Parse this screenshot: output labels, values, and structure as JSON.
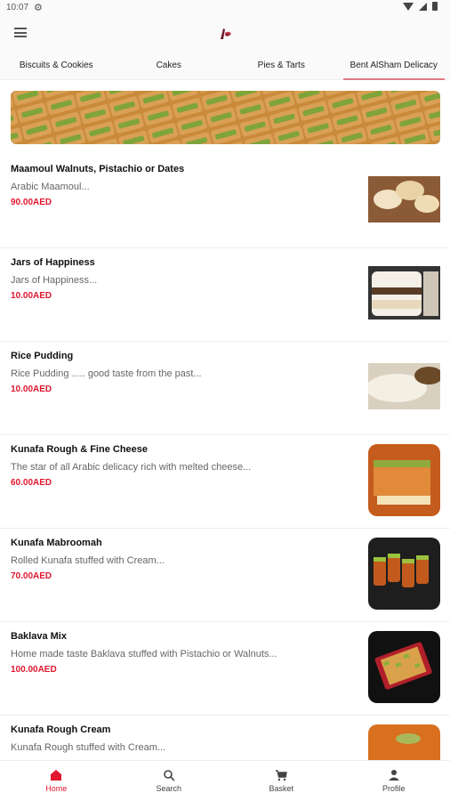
{
  "status": {
    "time": "10:07"
  },
  "tabs": [
    {
      "label": "Biscuits & Cookies"
    },
    {
      "label": "Cakes"
    },
    {
      "label": "Pies & Tarts"
    },
    {
      "label": "Bent AlSham Delicacy"
    }
  ],
  "items": [
    {
      "name": "Maamoul Walnuts, Pistachio or Dates",
      "desc": "Arabic Maamoul...",
      "price": "90.00AED"
    },
    {
      "name": "Jars of Happiness",
      "desc": "Jars of Happiness...",
      "price": "10.00AED"
    },
    {
      "name": "Rice Pudding",
      "desc": "Rice Pudding ..... good taste from the past...",
      "price": "10.00AED"
    },
    {
      "name": "Kunafa Rough & Fine Cheese",
      "desc": "The star of all Arabic delicacy rich with melted cheese...",
      "price": "60.00AED"
    },
    {
      "name": "Kunafa Mabroomah",
      "desc": "Rolled Kunafa stuffed with Cream...",
      "price": "70.00AED"
    },
    {
      "name": "Baklava Mix",
      "desc": "Home made taste Baklava stuffed with Pistachio or Walnuts...",
      "price": "100.00AED"
    },
    {
      "name": "Kunafa Rough Cream",
      "desc": "Kunafa Rough stuffed with Cream...",
      "price": ""
    }
  ],
  "nav": [
    {
      "label": "Home",
      "icon": "home-icon"
    },
    {
      "label": "Search",
      "icon": "search-icon"
    },
    {
      "label": "Basket",
      "icon": "basket-icon"
    },
    {
      "label": "Profile",
      "icon": "profile-icon"
    }
  ],
  "colors": {
    "accent": "#e0172f",
    "tab_indicator": "#e07c86"
  }
}
